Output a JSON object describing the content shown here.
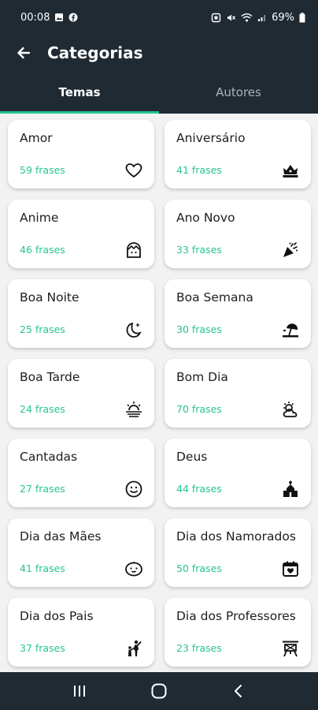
{
  "status_bar": {
    "time": "00:08",
    "battery": "69%"
  },
  "app_bar": {
    "title": "Categorias"
  },
  "tabs": [
    {
      "label": "Temas",
      "active": true
    },
    {
      "label": "Autores",
      "active": false
    }
  ],
  "colors": {
    "header": "#1f2a33",
    "accent": "#27c48f",
    "background": "#f2f2f2"
  },
  "categories": [
    {
      "name": "Amor",
      "count": "59 frases",
      "icon": "heart-icon"
    },
    {
      "name": "Aniversário",
      "count": "41 frases",
      "icon": "crown-icon"
    },
    {
      "name": "Anime",
      "count": "46 frases",
      "icon": "anime-face-icon"
    },
    {
      "name": "Ano Novo",
      "count": "33 frases",
      "icon": "party-popper-icon"
    },
    {
      "name": "Boa Noite",
      "count": "25 frases",
      "icon": "moon-star-icon"
    },
    {
      "name": "Boa Semana",
      "count": "30 frases",
      "icon": "beach-umbrella-icon"
    },
    {
      "name": "Boa Tarde",
      "count": "24 frases",
      "icon": "sunset-icon"
    },
    {
      "name": "Bom Dia",
      "count": "70 frases",
      "icon": "sun-cloud-icon"
    },
    {
      "name": "Cantadas",
      "count": "27 frases",
      "icon": "smile-icon"
    },
    {
      "name": "Deus",
      "count": "44 frases",
      "icon": "church-icon"
    },
    {
      "name": "Dia das Mães",
      "count": "41 frases",
      "icon": "baby-face-icon"
    },
    {
      "name": "Dia dos Namorados",
      "count": "50 frases",
      "icon": "calendar-heart-icon"
    },
    {
      "name": "Dia dos Pais",
      "count": "37 frases",
      "icon": "father-child-icon"
    },
    {
      "name": "Dia dos Professores",
      "count": "23 frases",
      "icon": "easel-icon"
    }
  ]
}
